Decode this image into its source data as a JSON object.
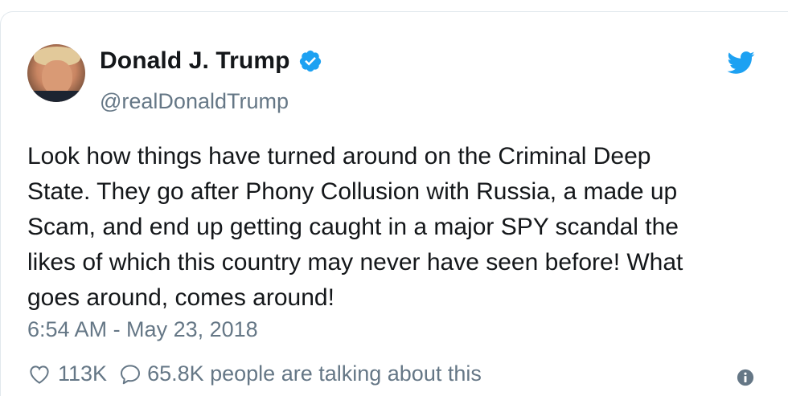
{
  "author": {
    "name": "Donald J. Trump",
    "handle": "@realDonaldTrump",
    "verified": true
  },
  "tweet": {
    "text": "Look how things have turned around on the Criminal Deep\nState. They go after Phony Collusion with Russia, a made up\nScam, and end up getting caught in a major SPY scandal the\nlikes of which this country may never have seen before! What\ngoes around, comes around!",
    "timestamp": "6:54 AM - May 23, 2018"
  },
  "engagement": {
    "likes": "113K",
    "talking": "65.8K people are talking about this"
  },
  "icons": {
    "verified": "verified-badge-icon",
    "bird": "twitter-bird-icon",
    "like": "heart-icon",
    "reply": "speech-bubble-icon",
    "info": "info-icon"
  },
  "colors": {
    "brand": "#1da1f2",
    "secondary_text": "#657786",
    "primary_text": "#14171a"
  }
}
